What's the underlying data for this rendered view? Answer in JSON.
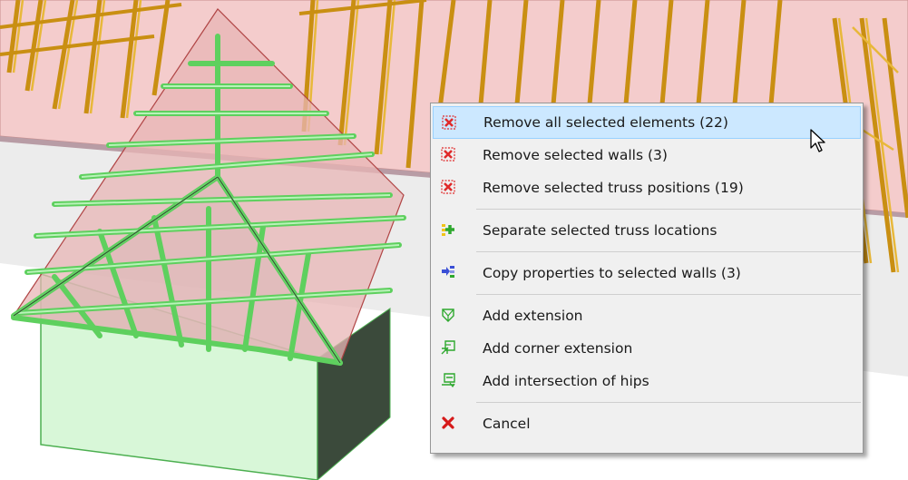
{
  "context_menu": {
    "items": [
      {
        "label": "Remove all selected elements (22)",
        "icon": "remove-red-x-icon"
      },
      {
        "label": "Remove selected walls (3)",
        "icon": "remove-red-x-icon"
      },
      {
        "label": "Remove selected truss positions (19)",
        "icon": "remove-red-x-icon"
      },
      {
        "label": "Separate selected truss locations",
        "icon": "separate-green-plus-icon"
      },
      {
        "label": "Copy properties to selected walls (3)",
        "icon": "copy-properties-icon"
      },
      {
        "label": "Add extension",
        "icon": "add-extension-icon"
      },
      {
        "label": "Add corner extension",
        "icon": "add-corner-extension-icon"
      },
      {
        "label": "Add intersection of hips",
        "icon": "add-intersection-hips-icon"
      },
      {
        "label": "Cancel",
        "icon": "cancel-icon"
      }
    ],
    "highlighted_item": "Remove all selected elements (22)"
  },
  "colors": {
    "roof_pink": "#f3c9c9",
    "truss_wood": "#d9a626",
    "selected_green": "#5ed05e",
    "menu_highlight": "#cce8ff",
    "remove_red": "#e02a2a",
    "cancel_red": "#d61a1a"
  }
}
